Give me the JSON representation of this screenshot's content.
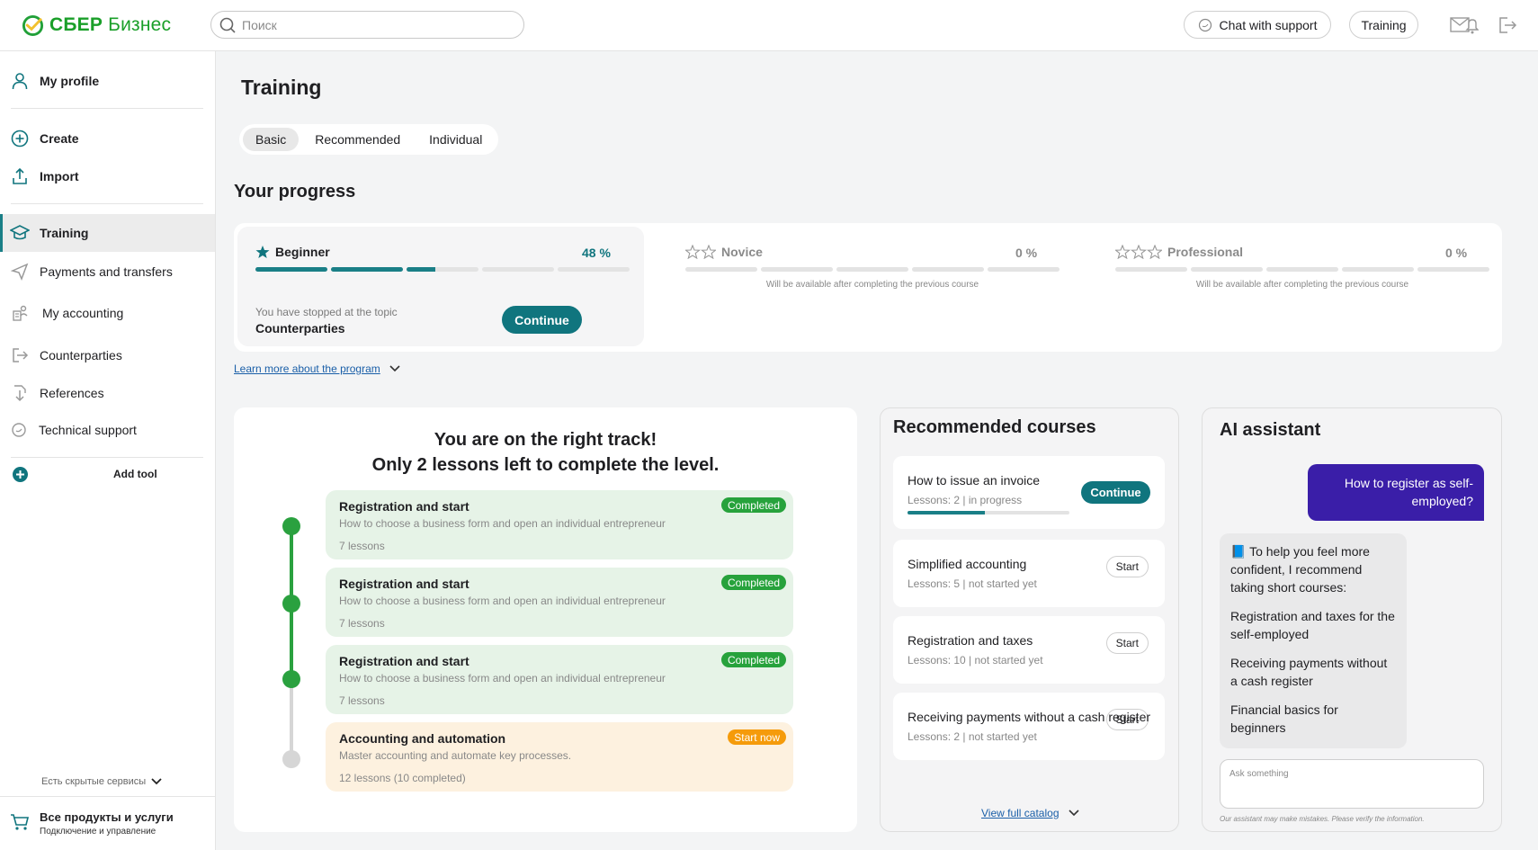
{
  "header": {
    "logo_text_bold": "СБЕР",
    "logo_text_light": "Бизнес",
    "search_placeholder": "Поиск",
    "chat_support_label": "Chat with support",
    "training_label": "Training",
    "icons": [
      "search-icon",
      "chat-bubble-icon",
      "mail-notification-icon",
      "logout-icon"
    ]
  },
  "sidebar": {
    "items": [
      {
        "label": "My profile",
        "icon": "user-icon"
      },
      {
        "label": "Create",
        "icon": "plus-circle-icon"
      },
      {
        "label": "Import",
        "icon": "upload-icon"
      },
      {
        "label": "Training",
        "icon": "graduation-cap-icon"
      },
      {
        "label": "Payments and transfers",
        "icon": "paper-plane-icon"
      },
      {
        "label": "My accounting",
        "icon": "accounting-icon"
      },
      {
        "label": "Counterparties",
        "icon": "exit-arrow-icon"
      },
      {
        "label": "References",
        "icon": "download-doc-icon"
      },
      {
        "label": "Technical support",
        "icon": "support-chat-icon"
      }
    ],
    "add_tool": "Add tool",
    "hidden_services": "Есть скрытые сервисы",
    "all_products_title": "Все продукты и услуги",
    "all_products_sub": "Подключение и управление"
  },
  "main": {
    "title": "Training",
    "tabs": [
      "Basic",
      "Recommended",
      "Individual"
    ],
    "progress_title": "Your progress",
    "levels": [
      {
        "name": "Beginner",
        "percent": "48 %",
        "progress_fraction": 0.48,
        "stars": 1
      },
      {
        "name": "Novice",
        "percent": "0 %",
        "progress_fraction": 0,
        "stars": 2,
        "note": "Will be available after completing the previous course"
      },
      {
        "name": "Professional",
        "percent": "0 %",
        "progress_fraction": 0,
        "stars": 3,
        "note": "Will be available after completing the previous course"
      }
    ],
    "stopped_label": "You have stopped at the topic",
    "stopped_topic": "Counterparties",
    "continue_label": "Continue",
    "learn_more": "Learn more about the program"
  },
  "track": {
    "title_line1": "You are on the right track!",
    "title_line2": "Only 2 lessons left to complete the level.",
    "lessons": [
      {
        "title": "Registration and start",
        "subtitle": "How to choose a business form and open an individual entrepreneur",
        "count": "7 lessons",
        "badge": "Completed"
      },
      {
        "title": "Registration and start",
        "subtitle": "How to choose a business form and open an individual entrepreneur",
        "count": "7 lessons",
        "badge": "Completed"
      },
      {
        "title": "Registration and start",
        "subtitle": "How to choose a business form and open an individual entrepreneur",
        "count": "7 lessons",
        "badge": "Completed"
      },
      {
        "title": "Accounting and automation",
        "subtitle": "Master accounting and automate key processes.",
        "count": "12 lessons (10 completed)",
        "badge": "Start now"
      }
    ]
  },
  "recommended": {
    "title": "Recommended courses",
    "courses": [
      {
        "title": "How to issue an invoice",
        "meta": "Lessons: 2 | in progress",
        "button": "Continue",
        "progress_fraction": 0.48
      },
      {
        "title": "Simplified accounting",
        "meta": "Lessons: 5 | not started yet",
        "button": "Start"
      },
      {
        "title": "Registration and taxes",
        "meta": "Lessons: 10 | not started yet",
        "button": "Start"
      },
      {
        "title": "Receiving payments without a cash register",
        "meta": "Lessons: 2 | not started yet",
        "button": "Start"
      }
    ],
    "view_catalog": "View full catalog"
  },
  "assistant": {
    "title": "AI assistant",
    "user_message": "How to register as self-employed?",
    "bot_intro": "📘 To help you feel more confident, I recommend taking short courses:",
    "bot_items": [
      "Registration and taxes for the self-employed",
      "Receiving payments without a cash register",
      "Financial basics for beginners"
    ],
    "input_placeholder": "Ask something",
    "disclaimer": "Our assistant may make mistakes. Please verify the information."
  },
  "colors": {
    "brand_green": "#1a9f29",
    "teal": "#10757e",
    "purple": "#3a1ea8",
    "badge_green": "#27a23c",
    "badge_orange": "#f59b0b"
  }
}
